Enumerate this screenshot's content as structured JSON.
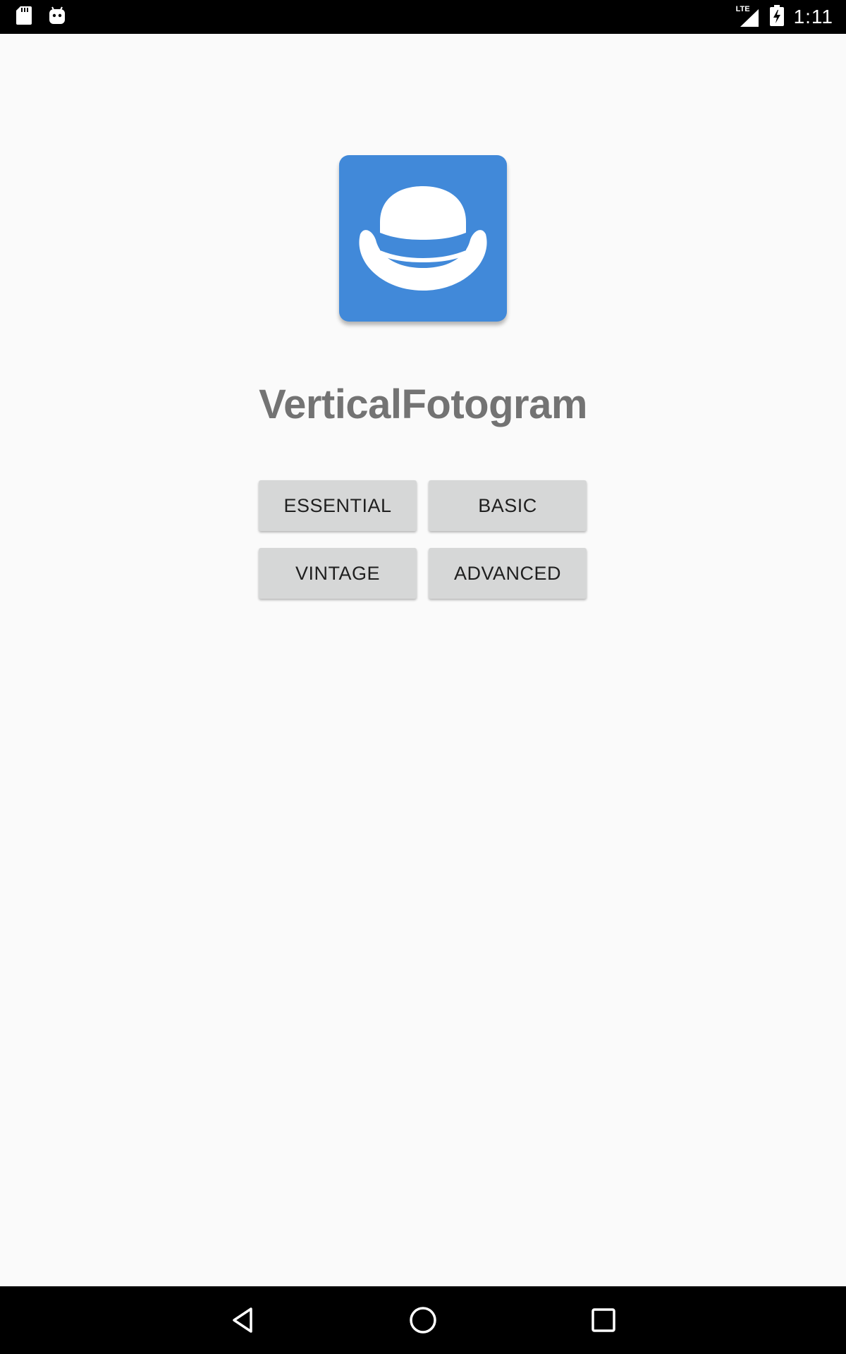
{
  "status_bar": {
    "time": "1:11",
    "network_label": "LTE",
    "icons": [
      "sd-card-icon",
      "android-icon",
      "signal-icon",
      "battery-charging-icon"
    ]
  },
  "app": {
    "title": "VerticalFotogram",
    "icon": "bowler-hat-icon",
    "icon_color": "#4189d9"
  },
  "buttons": {
    "essential": "ESSENTIAL",
    "basic": "BASIC",
    "vintage": "VINTAGE",
    "advanced": "ADVANCED"
  },
  "nav_bar": {
    "icons": [
      "back-icon",
      "home-icon",
      "recents-icon"
    ]
  }
}
